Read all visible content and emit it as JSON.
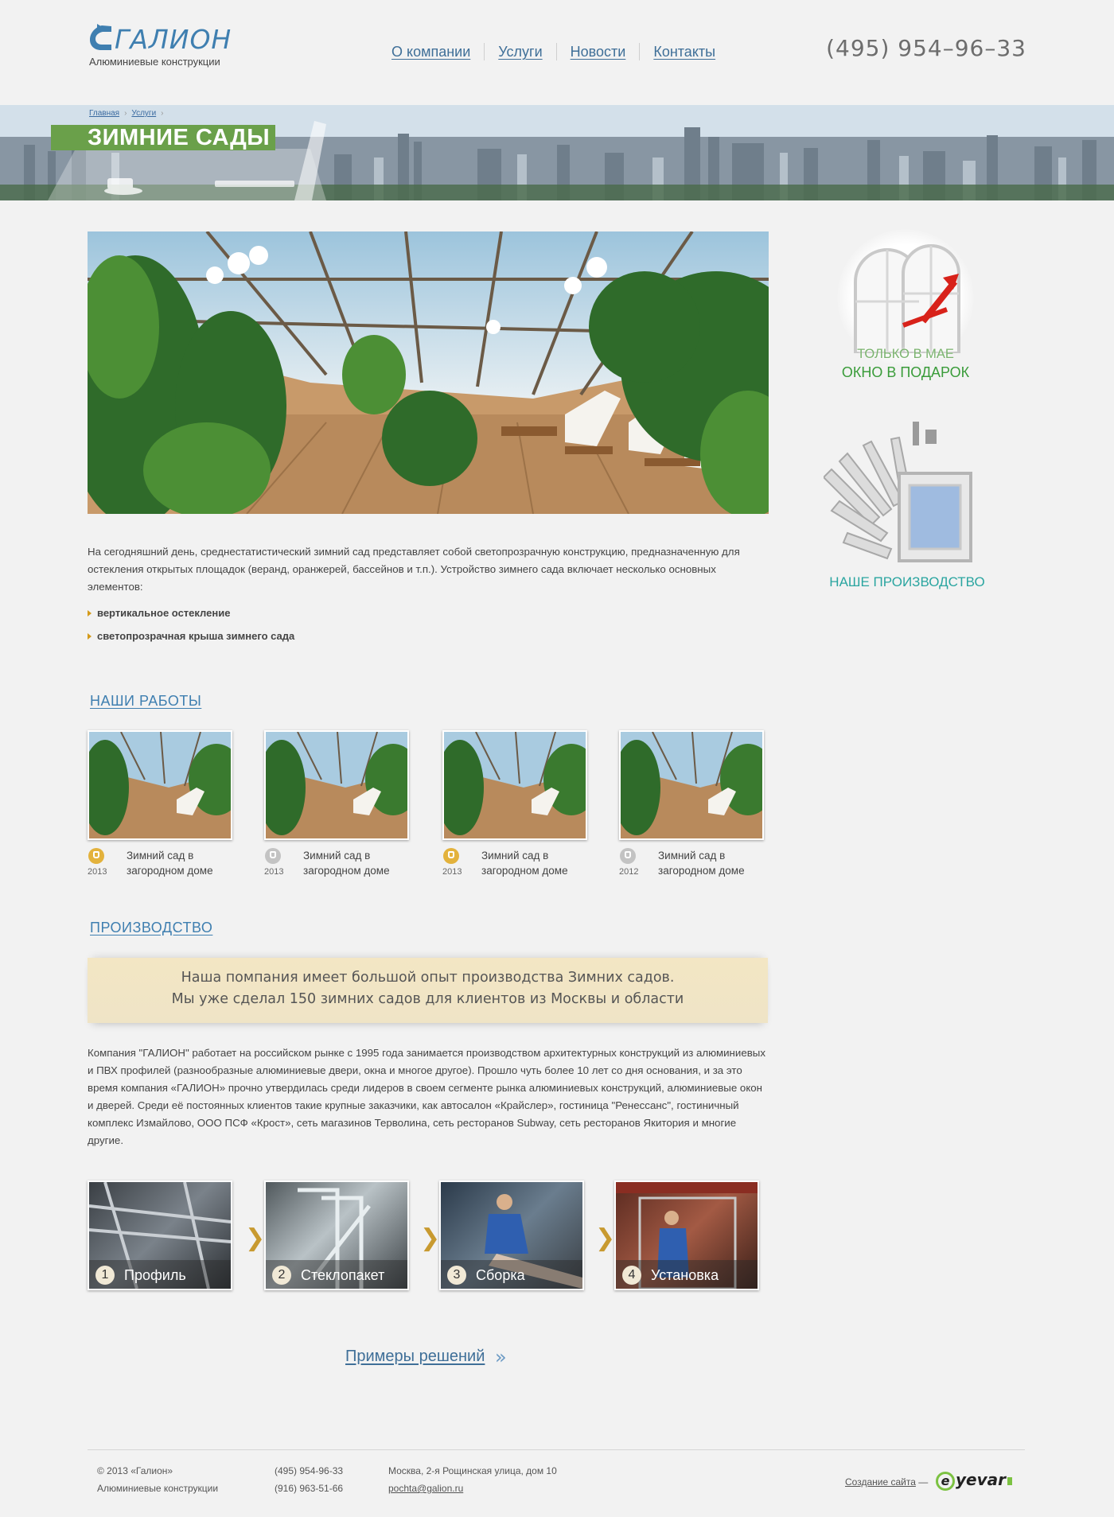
{
  "header": {
    "logo_name": "ГАЛИОН",
    "logo_subtitle": "Алюминиевые конструкции",
    "nav": [
      {
        "label": "О компании"
      },
      {
        "label": "Услуги"
      },
      {
        "label": "Новости"
      },
      {
        "label": "Контакты"
      }
    ],
    "phone": "(495) 954–96–33"
  },
  "banner": {
    "breadcrumbs": [
      "Главная",
      "Услуги"
    ],
    "title": "ЗИМНИЕ САДЫ"
  },
  "content": {
    "intro": "На сегодняшний день, среднестатистический зимний сад представляет собой светопрозрачную конструкцию, предназначенную для остекления открытых площадок (веранд, оранжерей, бассейнов и т.п.). Устройство зимнего сада включает несколько основных элементов:",
    "bullets": [
      "вертикальное остекление",
      "светопрозрачная крыша зимнего сада"
    ],
    "works_title": "НАШИ РАБОТЫ",
    "works": [
      {
        "label": "Зимний сад в загородном доме",
        "year": "2013",
        "icon": "thumbs-up-icon",
        "icon_color": "#e3b23c"
      },
      {
        "label": "Зимний сад в загородном доме",
        "year": "2013",
        "icon": "thumbs-up-icon",
        "icon_color": "#c3c3c3"
      },
      {
        "label": "Зимний сад в загородном доме",
        "year": "2013",
        "icon": "thumbs-up-icon",
        "icon_color": "#e3b23c"
      },
      {
        "label": "Зимний сад в загородном доме",
        "year": "2012",
        "icon": "thumbs-up-icon",
        "icon_color": "#c3c3c3"
      }
    ],
    "production_title": "ПРОИЗВОДСТВО",
    "quote_line1": "Наша помпания имеет большой опыт производства Зимних садов.",
    "quote_line2": "Мы уже сделал 150 зимних садов для клиентов из Москвы и области",
    "about": "Компания \"ГАЛИОН\" работает на российском рынке с 1995 года занимается производством архитектурных конструкций из алюминиевых и ПВХ профилей (разнообразные алюминиевые двери, окна и многое другое). Прошло чуть более 10 лет со дня основания, и за это время компания «ГАЛИОН» прочно утвердилась среди лидеров в своем сегменте рынка алюминиевых конструкций, алюминиевые окон и дверей. Среди её постоянных клиентов такие крупные заказчики, как автосалон «Крайслер», гостиница \"Ренессанс\", гостиничный комплекс Измайлово, ООО ПСФ «Крост», сеть магазинов Терволина, сеть ресторанов Subway, сеть ресторанов Якитория и многие другие.",
    "steps": [
      {
        "num": "1",
        "label": "Профиль"
      },
      {
        "num": "2",
        "label": "Стеклопакет"
      },
      {
        "num": "3",
        "label": "Сборка"
      },
      {
        "num": "4",
        "label": "Установка"
      }
    ],
    "step_arrow": "❯",
    "examples_link": "Примеры решений",
    "examples_arrow": "»"
  },
  "sidebar": {
    "promo_line1": "ТОЛЬКО В МАЕ",
    "promo_line2": "ОКНО В ПОДАРОК",
    "production_link": "НАШЕ ПРОИЗВОДСТВО"
  },
  "footer": {
    "copyright": "© 2013  «Галион»",
    "company": "Алюминиевые конструкции",
    "phone1": "(495) 954-96-33",
    "phone2": "(916) 963-51-66",
    "address": "Москва, 2-я Рощинская улица, дом 10",
    "email": "pochta@galion.ru",
    "credit_link": "Создание сайта",
    "credit_dash": "—",
    "studio_letter": "e",
    "studio_name": "yevar"
  },
  "colors": {
    "accent_blue": "#3f7fb0",
    "title_green": "#6aa04a",
    "bullet_gold": "#d49a1a",
    "promo_green": "#3a9c3a",
    "production_teal": "#2aa5a0",
    "quote_bg": "#f3e6c4"
  }
}
